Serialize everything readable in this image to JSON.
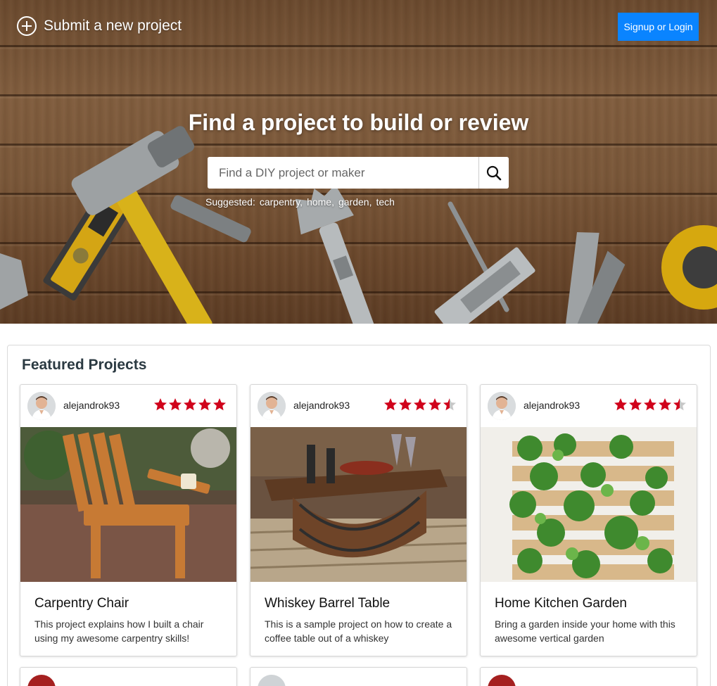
{
  "header": {
    "submit_label": "Submit a new project",
    "auth_label": "Signup or Login"
  },
  "hero": {
    "title": "Find a project to build or review",
    "search_placeholder": "Find a DIY project or maker",
    "suggested_label": "Suggested:",
    "suggested_tags": [
      "carpentry,",
      "home,",
      "garden,",
      "tech"
    ]
  },
  "featured": {
    "title": "Featured Projects",
    "projects": [
      {
        "author": "alejandrok93",
        "rating": 5,
        "title": "Carpentry Chair",
        "description": "This project explains how I built a chair using my awesome carpentry skills!"
      },
      {
        "author": "alejandrok93",
        "rating": 4.5,
        "title": "Whiskey Barrel Table",
        "description": "This is a sample project on how to create a coffee table out of a whiskey"
      },
      {
        "author": "alejandrok93",
        "rating": 4.5,
        "title": "Home Kitchen Garden",
        "description": "Bring a garden inside your home with this awesome vertical garden"
      }
    ]
  },
  "icons": {
    "submit": "plus-circle-icon",
    "search": "search-icon",
    "star": "star-icon"
  },
  "colors": {
    "accent": "#0a84ff",
    "star": "#d0021b",
    "star_empty": "#c8c8c8"
  }
}
